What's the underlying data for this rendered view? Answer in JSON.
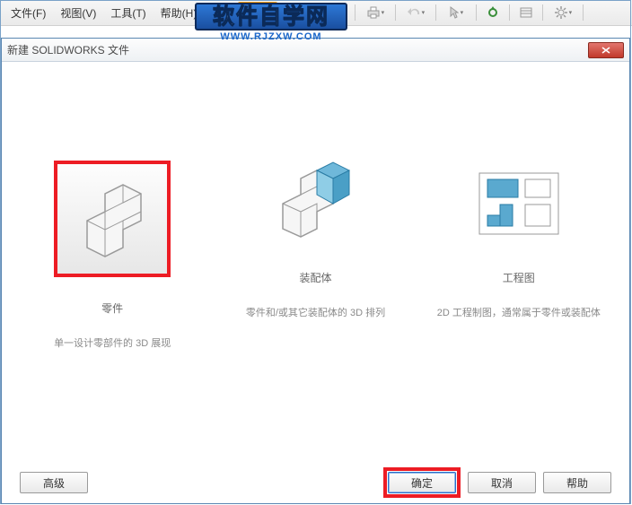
{
  "menubar": {
    "file": "文件(F)",
    "view": "视图(V)",
    "tools": "工具(T)",
    "help": "帮助(H)"
  },
  "watermark": {
    "title_cn": "软件自学网",
    "title_en": "WWW.RJZXW.COM"
  },
  "dialog": {
    "title": "新建 SOLIDWORKS 文件",
    "options": {
      "part": {
        "name": "零件",
        "desc": "单一设计零部件的 3D 展现"
      },
      "assembly": {
        "name": "装配体",
        "desc": "零件和/或其它装配体的 3D 排列"
      },
      "drawing": {
        "name": "工程图",
        "desc": "2D 工程制图，通常属于零件或装配体"
      }
    },
    "buttons": {
      "advanced": "高级",
      "ok": "确定",
      "cancel": "取消",
      "help": "帮助"
    }
  }
}
